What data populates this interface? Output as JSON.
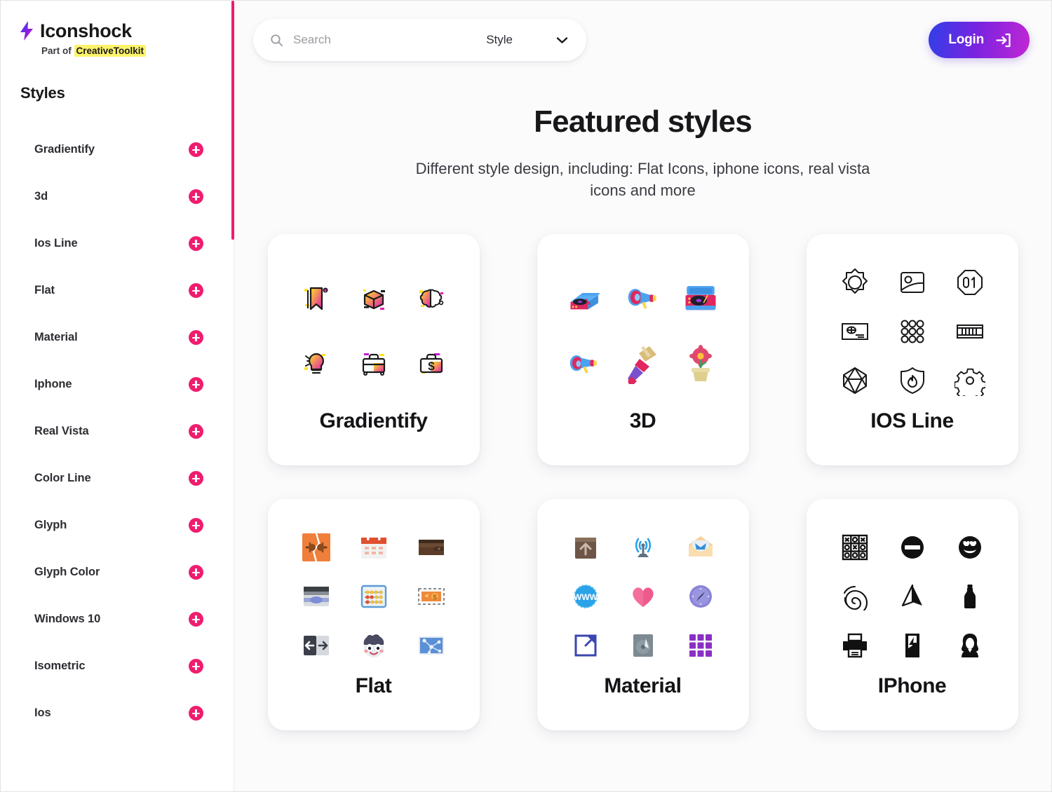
{
  "brand": {
    "icon": "lightning-bolt-icon",
    "name": "Iconshock",
    "tagline_prefix": "Part of ",
    "tagline_highlight": "CreativeToolkit"
  },
  "sidebar": {
    "heading": "Styles",
    "items": [
      {
        "label": "Gradientify",
        "action_icon": "plus-icon"
      },
      {
        "label": "3d",
        "action_icon": "plus-icon"
      },
      {
        "label": "Ios Line",
        "action_icon": "plus-icon"
      },
      {
        "label": "Flat",
        "action_icon": "plus-icon"
      },
      {
        "label": "Material",
        "action_icon": "plus-icon"
      },
      {
        "label": "Iphone",
        "action_icon": "plus-icon"
      },
      {
        "label": "Real Vista",
        "action_icon": "plus-icon"
      },
      {
        "label": "Color Line",
        "action_icon": "plus-icon"
      },
      {
        "label": "Glyph",
        "action_icon": "plus-icon"
      },
      {
        "label": "Glyph Color",
        "action_icon": "plus-icon"
      },
      {
        "label": "Windows 10",
        "action_icon": "plus-icon"
      },
      {
        "label": "Isometric",
        "action_icon": "plus-icon"
      },
      {
        "label": "Ios",
        "action_icon": "plus-icon"
      }
    ]
  },
  "topbar": {
    "search": {
      "icon": "search-icon",
      "placeholder": "Search",
      "value": ""
    },
    "style_dropdown": {
      "selected": "Style",
      "icon": "chevron-down-icon"
    },
    "login": {
      "label": "Login",
      "icon": "login-arrow-icon"
    }
  },
  "hero": {
    "title": "Featured styles",
    "subtitle": "Different style design, including: Flat Icons, iphone icons, real vista icons and more"
  },
  "cards": [
    {
      "title": "Gradientify",
      "icons": [
        "bookmark-icon",
        "box-icon",
        "brain-icon",
        "lightbulb-icon",
        "briefcase-icon",
        "money-briefcase-icon"
      ]
    },
    {
      "title": "3D",
      "icons": [
        "record-player-open-icon",
        "megaphone-icon",
        "turntable-icon",
        "megaphone-side-icon",
        "paintbrush-icon",
        "potted-flower-icon"
      ]
    },
    {
      "title": "IOS Line",
      "icons": [
        "sun-burst-icon",
        "photo-icon",
        "octagon-01-icon",
        "id-card-icon",
        "dots-grid-icon",
        "barcode-container-icon",
        "polyhedron-icon",
        "shield-flame-icon",
        "gear-icon"
      ]
    },
    {
      "title": "Flat",
      "icons": [
        "broken-connection-icon",
        "calendar-icon",
        "wallet-icon",
        "browser-window-icon",
        "abacus-icon",
        "dollar-banknote-icon",
        "arrows-left-right-icon",
        "mascot-face-icon",
        "network-map-icon"
      ]
    },
    {
      "title": "Material",
      "icons": [
        "box-upload-icon",
        "antenna-signal-icon",
        "open-envelope-icon",
        "www-globe-icon",
        "heart-icon",
        "compass-icon",
        "external-link-icon",
        "hard-drive-icon",
        "apps-grid-icon"
      ]
    },
    {
      "title": "IPhone",
      "icons": [
        "tic-tac-toe-icon",
        "no-entry-icon",
        "heart-eyes-smiley-icon",
        "fingerprint-icon",
        "paper-plane-icon",
        "bottle-icon",
        "printer-icon",
        "battery-bolt-icon",
        "woman-avatar-icon"
      ]
    }
  ],
  "colors": {
    "accent_pink": "#ef1d6e",
    "highlight_yellow": "#fdf36b",
    "login_gradient_start": "#2f3fe8",
    "login_gradient_end": "#c227d4",
    "text_dark": "#18181b",
    "background": "#fbfbfc"
  }
}
